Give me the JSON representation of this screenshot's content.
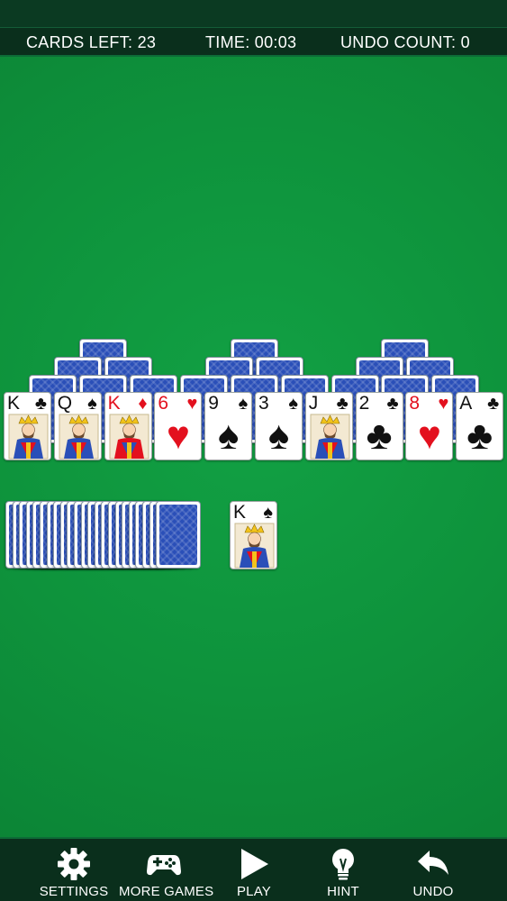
{
  "status": {
    "cards_left": "CARDS LEFT: 23",
    "time": "TIME: 00:03",
    "undo_count": "UNDO COUNT:  0"
  },
  "tableau_bottom_row": [
    {
      "rank": "K",
      "suit": "♣",
      "color": "black",
      "face": true
    },
    {
      "rank": "Q",
      "suit": "♠",
      "color": "black",
      "face": true
    },
    {
      "rank": "K",
      "suit": "♦",
      "color": "red",
      "face": true
    },
    {
      "rank": "6",
      "suit": "♥",
      "color": "red",
      "face": false
    },
    {
      "rank": "9",
      "suit": "♠",
      "color": "black",
      "face": false
    },
    {
      "rank": "3",
      "suit": "♠",
      "color": "black",
      "face": false
    },
    {
      "rank": "J",
      "suit": "♣",
      "color": "black",
      "face": true
    },
    {
      "rank": "2",
      "suit": "♣",
      "color": "black",
      "face": false
    },
    {
      "rank": "8",
      "suit": "♥",
      "color": "red",
      "face": false
    },
    {
      "rank": "A",
      "suit": "♣",
      "color": "black",
      "face": false
    }
  ],
  "waste_card": {
    "rank": "K",
    "suit": "♠",
    "color": "black",
    "face": true
  },
  "toolbar": {
    "settings": "SETTINGS",
    "more_games": "MORE GAMES",
    "play": "PLAY",
    "hint": "HINT",
    "undo": "UNDO"
  },
  "colors": {
    "felt": "#0e8f3a",
    "bar": "#0a2f1c",
    "card_back": "#2a4fb8",
    "red_suit": "#e3101e"
  },
  "icons": [
    "gear-icon",
    "gamepad-icon",
    "play-icon",
    "lightbulb-icon",
    "undo-arrow-icon"
  ]
}
